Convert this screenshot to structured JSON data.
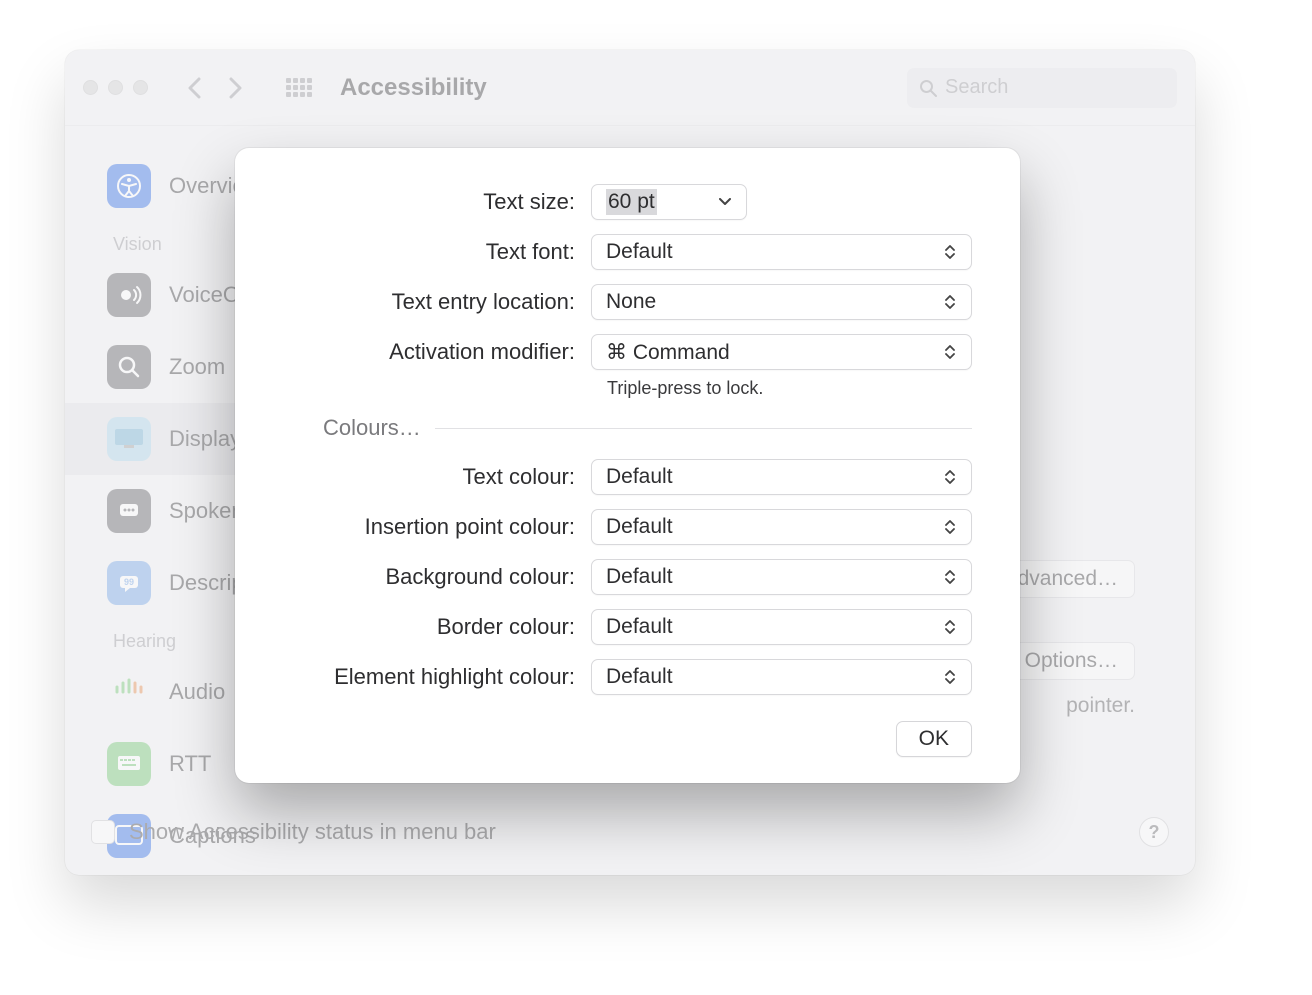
{
  "window": {
    "title": "Accessibility",
    "search_placeholder": "Search"
  },
  "sidebar": {
    "items": [
      {
        "label": "Overview",
        "section": null,
        "icon_bg": "#2e6be6"
      },
      {
        "label": "VoiceOver",
        "section": "Vision",
        "icon_bg": "#5e5e63"
      },
      {
        "label": "Zoom",
        "section": null,
        "icon_bg": "#5e5e63"
      },
      {
        "label": "Display",
        "section": null,
        "icon_bg": "#a9d3e8"
      },
      {
        "label": "Spoken Content",
        "section": null,
        "icon_bg": "#5e5e63"
      },
      {
        "label": "Descriptions",
        "section": null,
        "icon_bg": "#70a4e6"
      },
      {
        "label": "Audio",
        "section": "Hearing",
        "icon_bg": "#e8e8ea"
      },
      {
        "label": "RTT",
        "section": null,
        "icon_bg": "#6fc66f"
      },
      {
        "label": "Captions",
        "section": null,
        "icon_bg": "#2e6be6"
      }
    ],
    "section_vision": "Vision",
    "section_hearing": "Hearing"
  },
  "background_buttons": {
    "advanced": "Advanced…",
    "options": "Options…",
    "pointer_text": "pointer."
  },
  "footer": {
    "show_status_label": "Show Accessibility status in menu bar"
  },
  "modal": {
    "rows": {
      "text_size": {
        "label": "Text size:",
        "value": "60 pt"
      },
      "text_font": {
        "label": "Text font:",
        "value": "Default"
      },
      "text_entry_location": {
        "label": "Text entry location:",
        "value": "None"
      },
      "activation_modifier": {
        "label": "Activation modifier:",
        "value": "⌘ Command",
        "helper": "Triple-press to lock."
      }
    },
    "colours_section": "Colours…",
    "colour_rows": {
      "text_colour": {
        "label": "Text colour:",
        "value": "Default"
      },
      "insertion_point_colour": {
        "label": "Insertion point colour:",
        "value": "Default"
      },
      "background_colour": {
        "label": "Background colour:",
        "value": "Default"
      },
      "border_colour": {
        "label": "Border colour:",
        "value": "Default"
      },
      "element_highlight_colour": {
        "label": "Element highlight colour:",
        "value": "Default"
      }
    },
    "ok_label": "OK"
  }
}
